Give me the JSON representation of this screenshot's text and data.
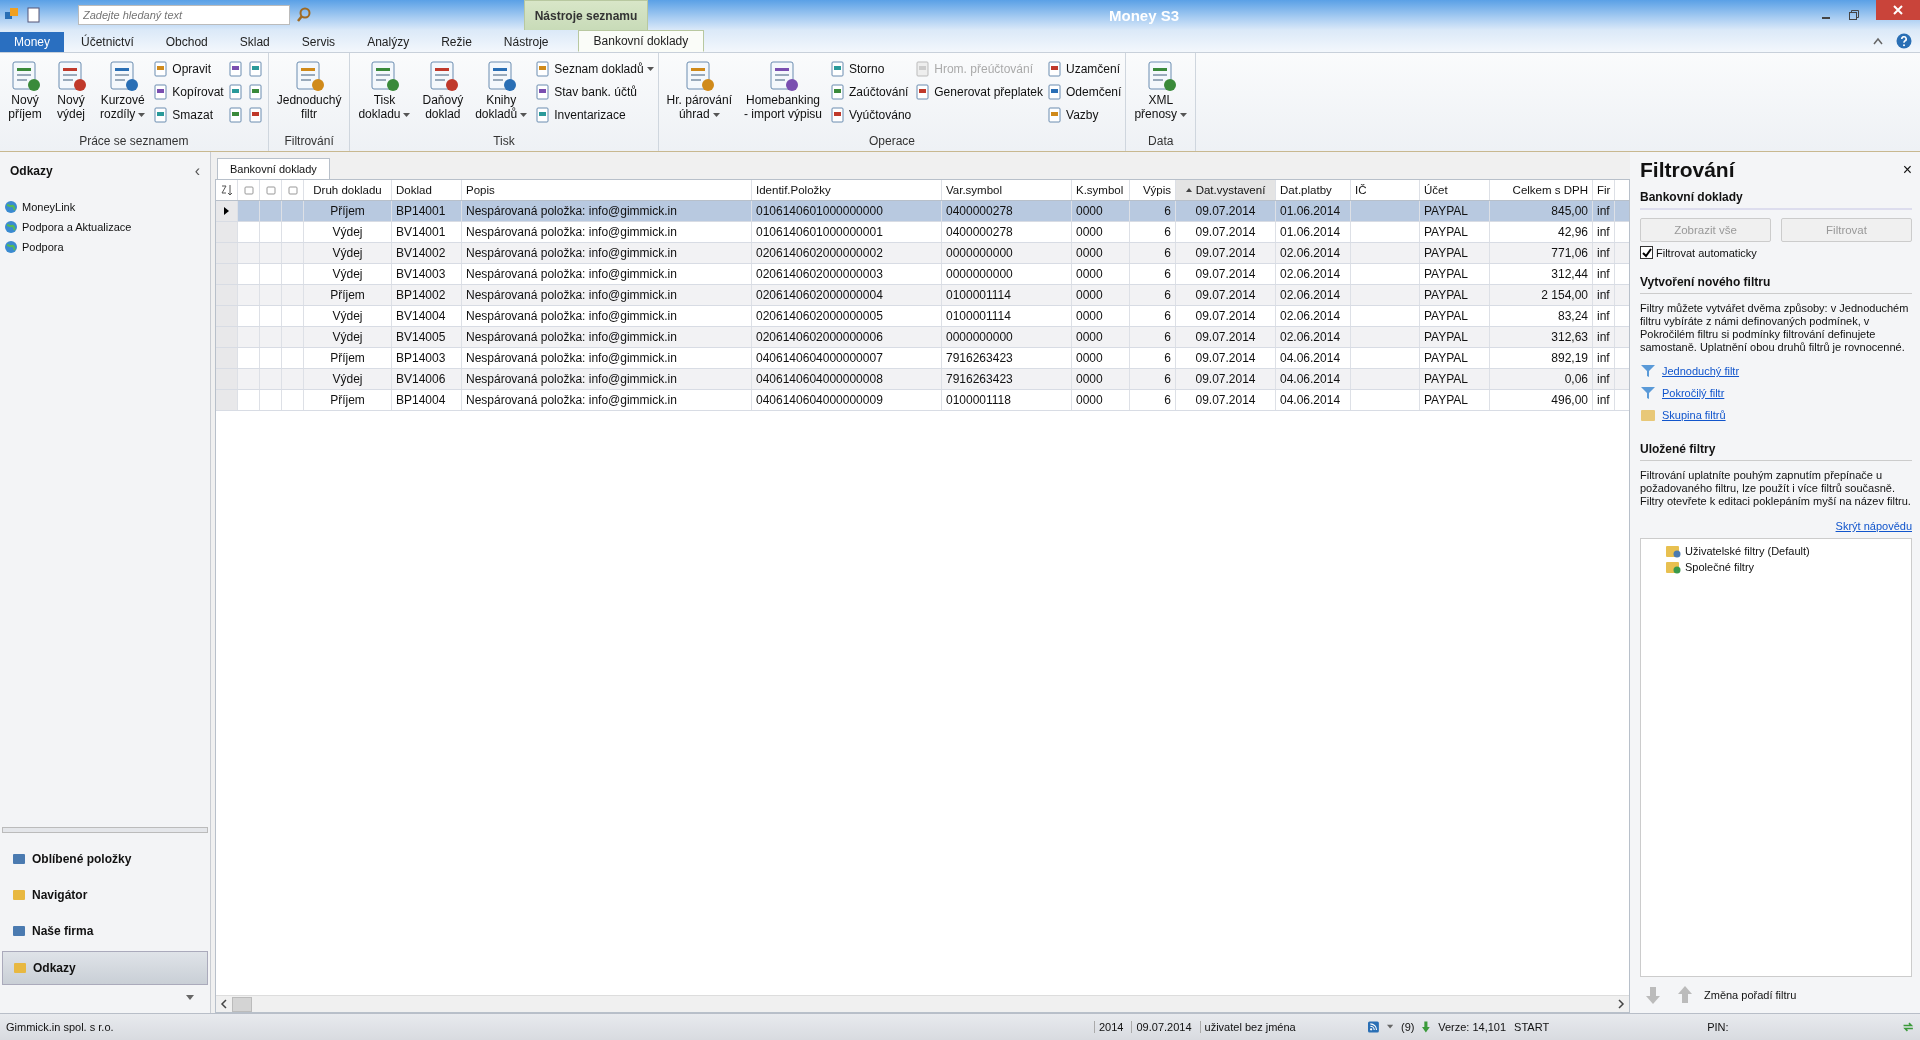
{
  "window": {
    "title": "Money S3",
    "context_tab": "Nástroje seznamu",
    "search": {
      "placeholder": "Zadejte hledaný text"
    }
  },
  "tabs": [
    {
      "label": "Money",
      "kind": "app",
      "selected": false
    },
    {
      "label": "Účetnictví",
      "kind": "tab",
      "selected": false
    },
    {
      "label": "Obchod",
      "kind": "tab",
      "selected": false
    },
    {
      "label": "Sklad",
      "kind": "tab",
      "selected": false
    },
    {
      "label": "Servis",
      "kind": "tab",
      "selected": false
    },
    {
      "label": "Analýzy",
      "kind": "tab",
      "selected": false
    },
    {
      "label": "Režie",
      "kind": "tab",
      "selected": false
    },
    {
      "label": "Nástroje",
      "kind": "tab",
      "selected": false
    },
    {
      "label": "Bankovní doklady",
      "kind": "context",
      "selected": true
    }
  ],
  "ribbon": [
    {
      "label": "Práce se seznamem",
      "columns": [
        [
          {
            "kind": "large",
            "label": "Nový\npříjem",
            "menu": false,
            "disabled": false
          }
        ],
        [
          {
            "kind": "large",
            "label": "Nový\nvýdej",
            "menu": false,
            "disabled": false
          }
        ],
        [
          {
            "kind": "large",
            "label": "Kurzové\nrozdíly",
            "menu": true,
            "disabled": false
          }
        ],
        [
          {
            "kind": "small",
            "label": "Opravit",
            "menu": false,
            "disabled": false
          },
          {
            "kind": "small",
            "label": "Kopírovat",
            "menu": false,
            "disabled": false
          },
          {
            "kind": "small",
            "label": "Smazat",
            "menu": false,
            "disabled": false
          }
        ],
        [
          {
            "kind": "icon"
          },
          {
            "kind": "icon"
          },
          {
            "kind": "icon"
          }
        ],
        [
          {
            "kind": "icon"
          },
          {
            "kind": "icon"
          },
          {
            "kind": "icon"
          }
        ]
      ]
    },
    {
      "label": "Filtrování",
      "columns": [
        [
          {
            "kind": "large",
            "label": "Jednoduchý\nfiltr",
            "menu": false,
            "disabled": false
          }
        ]
      ]
    },
    {
      "label": "Tisk",
      "columns": [
        [
          {
            "kind": "large",
            "label": "Tisk\ndokladu",
            "menu": true,
            "disabled": false
          }
        ],
        [
          {
            "kind": "large",
            "label": "Daňový\ndoklad",
            "menu": false,
            "disabled": false
          }
        ],
        [
          {
            "kind": "large",
            "label": "Knihy\ndokladů",
            "menu": true,
            "disabled": false
          }
        ],
        [
          {
            "kind": "small",
            "label": "Seznam dokladů",
            "menu": true,
            "disabled": false
          },
          {
            "kind": "small",
            "label": "Stav bank. účtů",
            "menu": false,
            "disabled": false
          },
          {
            "kind": "small",
            "label": "Inventarizace",
            "menu": false,
            "disabled": false
          }
        ]
      ]
    },
    {
      "label": "Operace",
      "columns": [
        [
          {
            "kind": "large",
            "label": "Hr. párování\núhrad",
            "menu": true,
            "disabled": false
          }
        ],
        [
          {
            "kind": "large",
            "label": "Homebanking\n- import výpisu",
            "menu": false,
            "disabled": false
          }
        ],
        [
          {
            "kind": "small",
            "label": "Storno",
            "menu": false,
            "disabled": false
          },
          {
            "kind": "small",
            "label": "Zaúčtování",
            "menu": false,
            "disabled": false
          },
          {
            "kind": "small",
            "label": "Vyúčtováno",
            "menu": false,
            "disabled": false
          }
        ],
        [
          {
            "kind": "small",
            "label": "Hrom. přeúčtování",
            "menu": false,
            "disabled": true
          },
          {
            "kind": "small",
            "label": "Generovat přeplatek",
            "menu": false,
            "disabled": false
          }
        ],
        [
          {
            "kind": "small",
            "label": "Uzamčení",
            "menu": false,
            "disabled": false
          },
          {
            "kind": "small",
            "label": "Odemčení",
            "menu": false,
            "disabled": false
          },
          {
            "kind": "small",
            "label": "Vazby",
            "menu": false,
            "disabled": false
          }
        ]
      ]
    },
    {
      "label": "Data",
      "columns": [
        [
          {
            "kind": "large",
            "label": "XML\npřenosy",
            "menu": true,
            "disabled": false
          }
        ]
      ]
    }
  ],
  "sidebar": {
    "title": "Odkazy",
    "collapse": "‹",
    "items": [
      "MoneyLink",
      "Podpora a Aktualizace",
      "Podpora"
    ],
    "nav": [
      {
        "label": "Oblíbené položky",
        "selected": false
      },
      {
        "label": "Navigátor",
        "selected": false
      },
      {
        "label": "Naše firma",
        "selected": false
      },
      {
        "label": "Odkazy",
        "selected": true
      }
    ]
  },
  "document_tab": "Bankovní doklady",
  "table": {
    "columns": [
      "Druh dokladu",
      "Doklad",
      "Popis",
      "Identif.Položky",
      "Var.symbol",
      "K.symbol",
      "Výpis",
      "Dat.vystavení",
      "Dat.platby",
      "IČ",
      "Účet",
      "Celkem s DPH",
      "Fir"
    ],
    "rows": [
      {
        "selected": true,
        "cells": [
          "Příjem",
          "BP14001",
          "Nespárovaná položka: info@gimmick.in",
          "0106140601000000000",
          "0400000278",
          "0000",
          "6",
          "09.07.2014",
          "01.06.2014",
          "",
          "PAYPAL",
          "845,00",
          "inf"
        ]
      },
      {
        "selected": false,
        "cells": [
          "Výdej",
          "BV14001",
          "Nespárovaná položka: info@gimmick.in",
          "0106140601000000001",
          "0400000278",
          "0000",
          "6",
          "09.07.2014",
          "01.06.2014",
          "",
          "PAYPAL",
          "42,96",
          "inf"
        ]
      },
      {
        "selected": false,
        "cells": [
          "Výdej",
          "BV14002",
          "Nespárovaná položka: info@gimmick.in",
          "0206140602000000002",
          "0000000000",
          "0000",
          "6",
          "09.07.2014",
          "02.06.2014",
          "",
          "PAYPAL",
          "771,06",
          "inf"
        ]
      },
      {
        "selected": false,
        "cells": [
          "Výdej",
          "BV14003",
          "Nespárovaná položka: info@gimmick.in",
          "0206140602000000003",
          "0000000000",
          "0000",
          "6",
          "09.07.2014",
          "02.06.2014",
          "",
          "PAYPAL",
          "312,44",
          "inf"
        ]
      },
      {
        "selected": false,
        "cells": [
          "Příjem",
          "BP14002",
          "Nespárovaná položka: info@gimmick.in",
          "0206140602000000004",
          "0100001114",
          "0000",
          "6",
          "09.07.2014",
          "02.06.2014",
          "",
          "PAYPAL",
          "2 154,00",
          "inf"
        ]
      },
      {
        "selected": false,
        "cells": [
          "Výdej",
          "BV14004",
          "Nespárovaná položka: info@gimmick.in",
          "0206140602000000005",
          "0100001114",
          "0000",
          "6",
          "09.07.2014",
          "02.06.2014",
          "",
          "PAYPAL",
          "83,24",
          "inf"
        ]
      },
      {
        "selected": false,
        "cells": [
          "Výdej",
          "BV14005",
          "Nespárovaná položka: info@gimmick.in",
          "0206140602000000006",
          "0000000000",
          "0000",
          "6",
          "09.07.2014",
          "02.06.2014",
          "",
          "PAYPAL",
          "312,63",
          "inf"
        ]
      },
      {
        "selected": false,
        "cells": [
          "Příjem",
          "BP14003",
          "Nespárovaná položka: info@gimmick.in",
          "0406140604000000007",
          "7916263423",
          "0000",
          "6",
          "09.07.2014",
          "04.06.2014",
          "",
          "PAYPAL",
          "892,19",
          "inf"
        ]
      },
      {
        "selected": false,
        "cells": [
          "Výdej",
          "BV14006",
          "Nespárovaná položka: info@gimmick.in",
          "0406140604000000008",
          "7916263423",
          "0000",
          "6",
          "09.07.2014",
          "04.06.2014",
          "",
          "PAYPAL",
          "0,06",
          "inf"
        ]
      },
      {
        "selected": false,
        "cells": [
          "Příjem",
          "BP14004",
          "Nespárovaná položka: info@gimmick.in",
          "0406140604000000009",
          "0100001118",
          "0000",
          "6",
          "09.07.2014",
          "04.06.2014",
          "",
          "PAYPAL",
          "496,00",
          "inf"
        ]
      }
    ]
  },
  "filter_panel": {
    "title": "Filtrování",
    "close": "×",
    "section": "Bankovní doklady",
    "buttons": [
      {
        "label": "Zobrazit vše",
        "disabled": true
      },
      {
        "label": "Filtrovat",
        "disabled": true
      }
    ],
    "auto_filter": {
      "label": "Filtrovat automaticky",
      "checked": true
    },
    "new_heading": "Vytvoření nového filtru",
    "new_text": "Filtry můžete vytvářet dvěma způsoby: v Jednoduchém filtru vybíráte z námi definovaných podmínek, v Pokročilém filtru si podmínky filtrování definujete samostaně. Uplatnění obou druhů filtrů je rovnocenné.",
    "links": [
      "Jednoduchý filtr",
      "Pokročilý filtr",
      "Skupina filtrů"
    ],
    "saved_heading": "Uložené filtry",
    "saved_text": "Filtrování uplatníte pouhým zapnutím přepínače u požadovaného filtru, lze použít i více filtrů současně. Filtry otevřete k editaci poklepáním myší na název filtru.",
    "hide_help": "Skrýt nápovědu",
    "tree": [
      "Uživatelské filtry (Default)",
      "Společné filtry"
    ],
    "order_label": "Změna pořadí filtru"
  },
  "status_bar": {
    "company": "Gimmick.in spol. s r.o.",
    "year": "2014",
    "date": "09.07.2014",
    "user": "uživatel bez jména",
    "count": "(9)",
    "version": "Verze: 14,101",
    "mode": "START",
    "pin": "PIN:"
  }
}
